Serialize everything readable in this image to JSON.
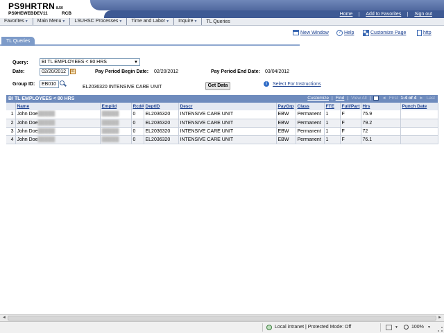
{
  "header": {
    "db_name": "PS9HRTRN",
    "version": "8.50",
    "server": "PS9HEWEBDEV11",
    "user": "RCB",
    "links": [
      "Home",
      "Add to Favorites",
      "Sign out"
    ]
  },
  "menu": [
    "Favorites",
    "Main Menu",
    "LSUHSC Processes",
    "Time and Labor",
    "Inquire",
    "TL Queries"
  ],
  "pagebar": {
    "new_window": "New Window",
    "help": "Help",
    "customize_page": "Customize Page",
    "http": "http"
  },
  "tab": "TL Queries",
  "form": {
    "query_label": "Query:",
    "query_value": "BI TL EMPLOYEES < 80 HRS",
    "date_label": "Date:",
    "date_value": "02/20/2012",
    "ppb_label": "Pay Period Begin Date:",
    "ppb_value": "02/20/2012",
    "ppe_label": "Pay Period End Date:",
    "ppe_value": "03/04/2012",
    "group_label": "Group ID:",
    "group_value": "EB010",
    "group_desc": "EL2036320 INTENSIVE CARE UNIT",
    "get_data": "Get Data",
    "select_instructions": "Select For Instructions"
  },
  "grid": {
    "title": "BI TL EMPLOYEES < 80 HRS",
    "nav": {
      "customize": "Customize",
      "find": "Find",
      "view_all": "View All",
      "first": "First",
      "range": "1-4 of 4",
      "last": "Last"
    },
    "columns": [
      "",
      "Name",
      "Emplid",
      "Rcd#",
      "DeptID",
      "Descr",
      "PayGrp",
      "Class",
      "FTE",
      "Full/Part",
      "Hrs",
      "Punch Date"
    ],
    "rows": [
      {
        "n": "1",
        "name": "John Doe",
        "rcd": "0",
        "dept": "EL2036320",
        "descr": "INTENSIVE CARE UNIT",
        "paygrp": "EBW",
        "class": "Permanent",
        "fte": "1",
        "fp": "F",
        "hrs": "75.9",
        "punch": ""
      },
      {
        "n": "2",
        "name": "John Doe",
        "rcd": "0",
        "dept": "EL2036320",
        "descr": "INTENSIVE CARE UNIT",
        "paygrp": "EBW",
        "class": "Permanent",
        "fte": "1",
        "fp": "F",
        "hrs": "79.2",
        "punch": ""
      },
      {
        "n": "3",
        "name": "John Doe",
        "rcd": "0",
        "dept": "EL2036320",
        "descr": "INTENSIVE CARE UNIT",
        "paygrp": "EBW",
        "class": "Permanent",
        "fte": "1",
        "fp": "F",
        "hrs": "72",
        "punch": ""
      },
      {
        "n": "4",
        "name": "John Doe",
        "rcd": "0",
        "dept": "EL2036320",
        "descr": "INTENSIVE CARE UNIT",
        "paygrp": "EBW",
        "class": "Permanent",
        "fte": "1",
        "fp": "F",
        "hrs": "76.1",
        "punch": ""
      }
    ]
  },
  "status": {
    "zone": "Local intranet | Protected Mode: Off",
    "zoom": "100%"
  }
}
